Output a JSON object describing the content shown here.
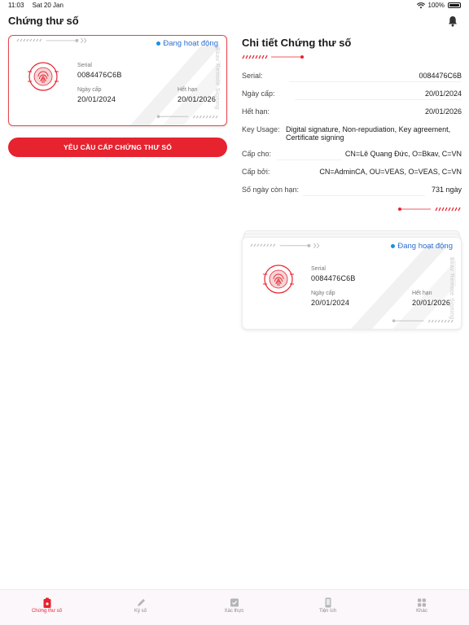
{
  "status_bar": {
    "time": "11:03",
    "date": "Sat 20 Jan",
    "battery": "100%"
  },
  "header": {
    "title": "Chứng thư số"
  },
  "card": {
    "status": "Đang hoạt động",
    "serial_label": "Serial",
    "serial": "0084476C6B",
    "issue_label": "Ngày cấp",
    "issue_date": "20/01/2024",
    "expiry_label": "Hết hạn",
    "expiry_date": "20/01/2026",
    "vertical_brand": "Bkav Remote Signing"
  },
  "request_button": {
    "label": "YÊU CẦU CẤP CHỨNG THƯ SỐ"
  },
  "detail": {
    "title": "Chi tiết Chứng thư số",
    "rows": [
      {
        "key": "Serial:",
        "value": "0084476C6B"
      },
      {
        "key": "Ngày cấp:",
        "value": "20/01/2024"
      },
      {
        "key": "Hết hạn:",
        "value": "20/01/2026"
      },
      {
        "key": "Key Usage:",
        "value": "Digital signature, Non-repudiation, Key agreement, Certificate signing"
      },
      {
        "key": "Cấp cho:",
        "value": "CN=Lê Quang Đức, O=Bkav, C=VN"
      },
      {
        "key": "Cấp bởi:",
        "value": "CN=AdminCA, OU=VEAS, O=VEAS, C=VN"
      },
      {
        "key": "Số ngày còn hạn:",
        "value": "731 ngày"
      }
    ]
  },
  "tabs": [
    {
      "label": "Chứng thư số",
      "icon": "certificate-icon",
      "active": true
    },
    {
      "label": "Ký số",
      "icon": "pen-icon",
      "active": false
    },
    {
      "label": "Xác thực",
      "icon": "check-icon",
      "active": false
    },
    {
      "label": "Tiện ích",
      "icon": "phone-icon",
      "active": false
    },
    {
      "label": "Khác",
      "icon": "grid-icon",
      "active": false
    }
  ],
  "colors": {
    "accent": "#e6232f",
    "status_blue": "#2c6fd1"
  }
}
